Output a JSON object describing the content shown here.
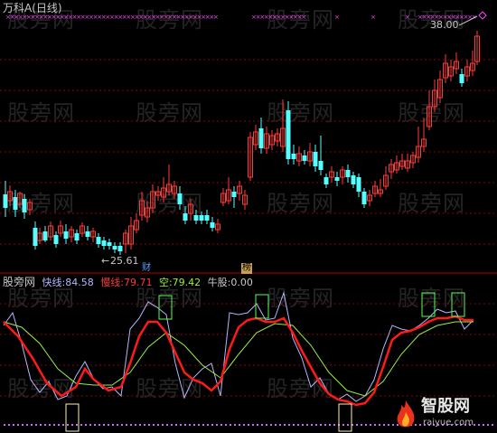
{
  "header": {
    "title": "万科A(日线)"
  },
  "price": {
    "high_label": "38.00",
    "low_label": "25.61"
  },
  "markers": {
    "cai": "财",
    "bang": "榜"
  },
  "indicator": {
    "name": "股旁网",
    "fast_label": "快线:",
    "fast_value": "84.58",
    "slow_label": "慢线:",
    "slow_value": "79.71",
    "empty_label": "空:",
    "empty_value": "79.42",
    "bull_label": "牛股:",
    "bull_value": "0.00"
  },
  "watermarks": [
    "股旁网",
    "股旁网",
    "股旁网",
    "股旁网",
    "股旁网",
    "股旁网",
    "股旁网",
    "股旁网",
    "股旁网",
    "股旁网",
    "股旁网",
    "股旁网",
    "股旁网",
    "股旁网",
    "股旁网",
    "股旁网",
    "股旁网",
    "股旁网",
    "股旁网",
    "股旁网"
  ],
  "logo": {
    "name": "智股网",
    "url": "raiyue.com"
  },
  "colors": {
    "up": "#ff3b3b",
    "down": "#55ffff",
    "fast": "#b5b5ff",
    "slow": "#ff1a1a",
    "empty": "#99ee44",
    "signal": "#55ff55",
    "bottom": "#ffeebb",
    "grid": "#8b0000",
    "marker": "#ff44ff",
    "text": "#c8c8c8"
  }
}
